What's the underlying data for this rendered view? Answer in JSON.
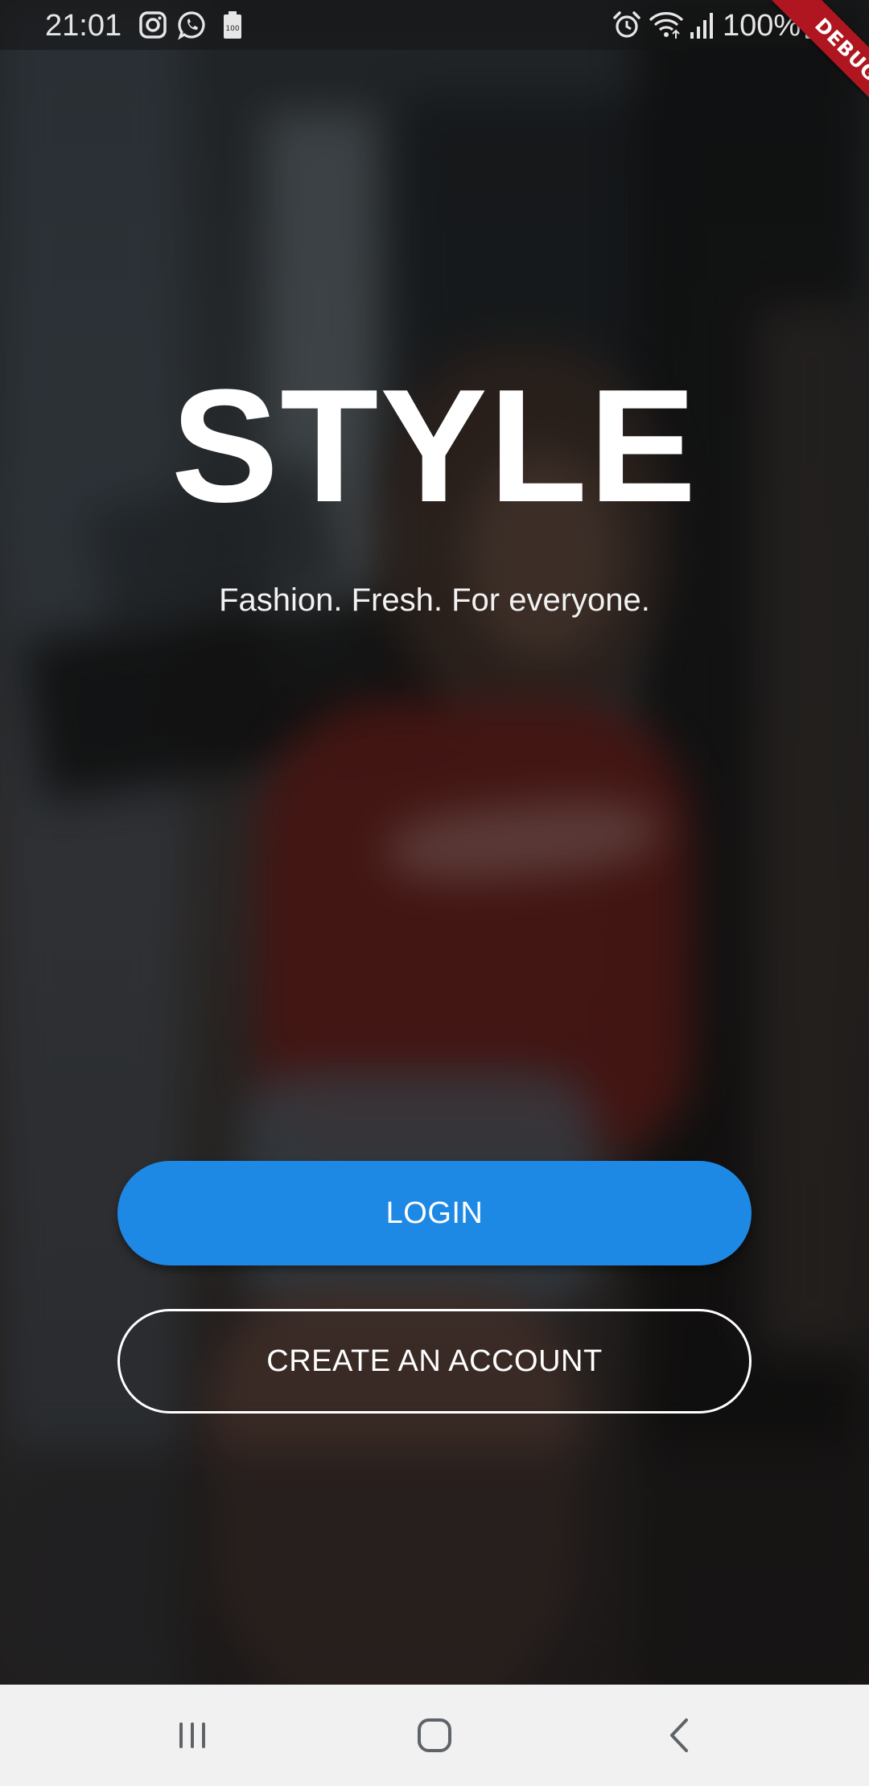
{
  "status_bar": {
    "time": "21:01",
    "battery_percent": "100%",
    "notification_icons": [
      "instagram-icon",
      "whatsapp-icon",
      "battery-100-icon"
    ],
    "system_icons": [
      "alarm-icon",
      "wifi-icon",
      "signal-icon",
      "battery-icon"
    ]
  },
  "debug_banner": {
    "label": "DEBUG"
  },
  "hero": {
    "title": "STYLE",
    "tagline": "Fashion. Fresh. For everyone."
  },
  "actions": {
    "login_label": "LOGIN",
    "create_account_label": "CREATE AN ACCOUNT"
  },
  "navigation_bar": {
    "buttons": [
      "recents-icon",
      "home-icon",
      "back-icon"
    ]
  },
  "colors": {
    "primary_button": "#1e88e5",
    "debug_banner": "#b0161f",
    "nav_bar_background": "#f1f1f1",
    "text": "#ffffff"
  }
}
